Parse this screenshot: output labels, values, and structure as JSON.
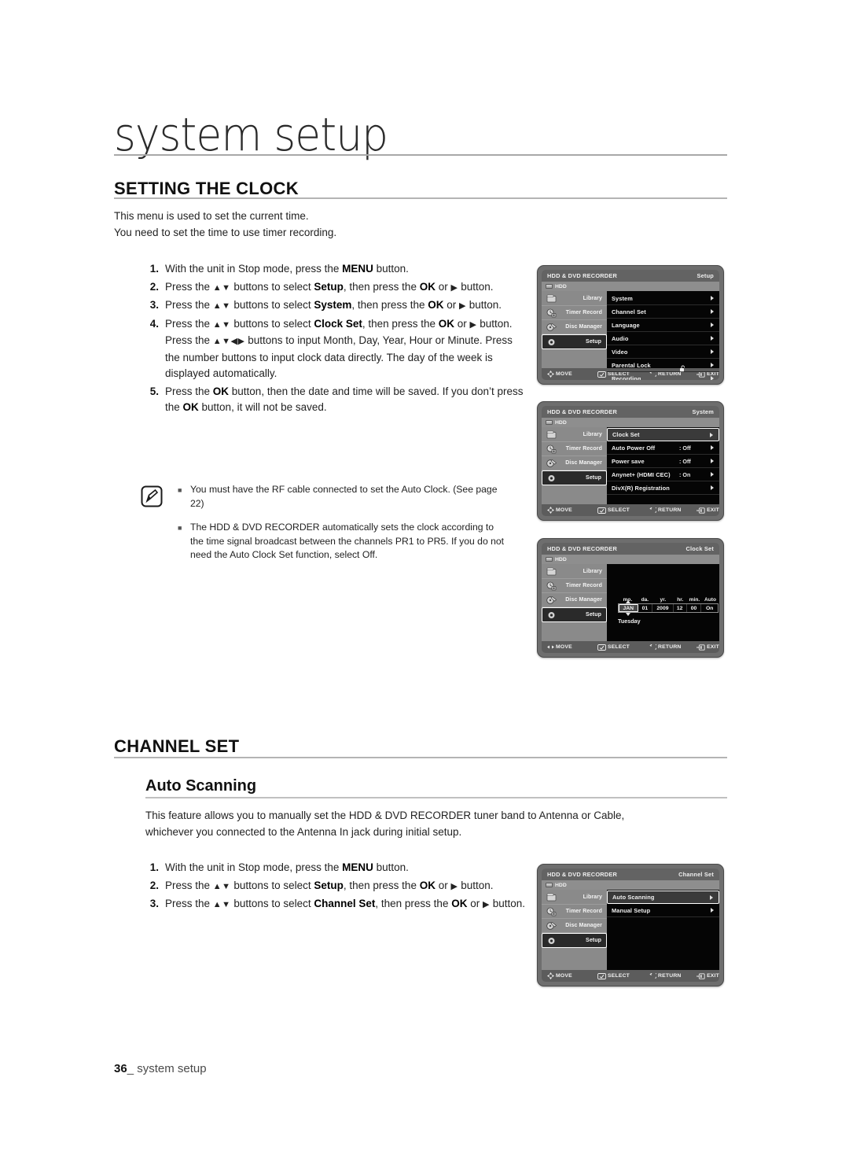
{
  "chapter": {
    "title": "system setup"
  },
  "sections": {
    "clock": {
      "heading": "SETTING THE CLOCK",
      "intro_line1": "This menu is used to set the current time.",
      "intro_line2": "You need to set the time to use timer recording.",
      "steps": [
        {
          "num": "1.",
          "html": "With the unit in Stop mode, press the <b>MENU</b> button."
        },
        {
          "num": "2.",
          "html": "Press the <span class=\"arrowg\">▲▼</span> buttons to select <b>Setup</b>, then press the <b>OK</b> or <span class=\"arrowg\">▶</span> button."
        },
        {
          "num": "3.",
          "html": "Press the <span class=\"arrowg\">▲▼</span> buttons to select <b>System</b>, then press the <b>OK</b> or <span class=\"arrowg\">▶</span> button."
        },
        {
          "num": "4.",
          "html": "Press the <span class=\"arrowg\">▲▼</span> buttons to select <b>Clock Set</b>, then press the <b>OK</b> or <span class=\"arrowg\">▶</span> button.<br>Press the <span class=\"arrowg\">▲▼◀▶</span> buttons to input Month, Day, Year, Hour or Minute. Press the number buttons to input clock data directly. The day of the week is displayed automatically."
        },
        {
          "num": "5.",
          "html": "Press the <b>OK</b> button, then the date and time will be saved. If you don&rsquo;t press the <b>OK</b> button, it will not be saved."
        }
      ],
      "notes": [
        "You must have the RF cable connected to set the Auto Clock. (See page 22)",
        "The HDD & DVD RECORDER automatically sets the clock according to the time signal broadcast between the channels PR1 to PR5. If you do not need the Auto Clock Set function, select Off."
      ]
    },
    "channel": {
      "heading": "CHANNEL SET",
      "subheading": "Auto Scanning",
      "intro_line1": "This feature allows you to manually set the HDD & DVD RECORDER tuner band to Antenna or Cable,",
      "intro_line2": "whichever you connected to the Antenna In jack during initial setup.",
      "steps": [
        {
          "num": "1.",
          "html": "With the unit in Stop mode, press the <b>MENU</b> button."
        },
        {
          "num": "2.",
          "html": "Press the <span class=\"arrowg\">▲▼</span> buttons to select <b>Setup</b>, then press the <b>OK</b> or <span class=\"arrowg\">▶</span> button."
        },
        {
          "num": "3.",
          "html": "Press the <span class=\"arrowg\">▲▼</span> buttons to select <b>Channel Set</b>, then press the <b>OK</b> or <span class=\"arrowg\">▶</span> button."
        }
      ]
    }
  },
  "osd_common": {
    "brand": "HDD & DVD RECORDER",
    "hdd_label": "HDD",
    "sidebar": [
      {
        "label": "Library",
        "icon": "library-icon"
      },
      {
        "label": "Timer Record",
        "icon": "timer-record-icon"
      },
      {
        "label": "Disc Manager",
        "icon": "disc-manager-icon"
      },
      {
        "label": "Setup",
        "icon": "setup-gear-icon"
      }
    ],
    "bottom_bar": {
      "move": "MOVE",
      "select": "SELECT",
      "return": "RETURN",
      "exit": "EXIT"
    }
  },
  "osd_screens": [
    {
      "id": "setup-menu",
      "page_title": "Setup",
      "selected_sidebar": 3,
      "move_mode": "updown",
      "rows": [
        {
          "label": "System",
          "value": "",
          "selected": false,
          "arrow": true
        },
        {
          "label": "Channel Set",
          "value": "",
          "selected": false,
          "arrow": true
        },
        {
          "label": "Language",
          "value": "",
          "selected": false,
          "arrow": true
        },
        {
          "label": "Audio",
          "value": "",
          "selected": false,
          "arrow": true
        },
        {
          "label": "Video",
          "value": "",
          "selected": false,
          "arrow": true
        },
        {
          "label": "Parental Lock",
          "value": "",
          "selected": false,
          "arrow": true,
          "icon": "unlocked-padlock-icon"
        },
        {
          "label": "Recording",
          "value": "",
          "selected": false,
          "arrow": true
        }
      ]
    },
    {
      "id": "system-menu",
      "page_title": "System",
      "selected_sidebar": 3,
      "move_mode": "updown",
      "rows": [
        {
          "label": "Clock Set",
          "value": "",
          "selected": true,
          "arrow": true
        },
        {
          "label": "Auto Power Off",
          "value": ": Off",
          "selected": false,
          "arrow": true
        },
        {
          "label": "Power save",
          "value": ": Off",
          "selected": false,
          "arrow": true
        },
        {
          "label": "Anynet+ (HDMI CEC)",
          "value": ": On",
          "selected": false,
          "arrow": true
        },
        {
          "label": "DivX(R) Registration",
          "value": "",
          "selected": false,
          "arrow": true
        }
      ]
    },
    {
      "id": "clock-set",
      "page_title": "Clock Set",
      "selected_sidebar": 3,
      "move_mode": "leftright",
      "clock": {
        "headers": [
          "mo.",
          "da.",
          "yr.",
          "hr.",
          "min.",
          "Auto"
        ],
        "values": [
          "JAN",
          "01",
          "2009",
          "12",
          "00",
          "On"
        ],
        "selected_index": 0,
        "weekday": "Tuesday"
      }
    },
    {
      "id": "channel-set",
      "page_title": "Channel Set",
      "selected_sidebar": 3,
      "move_mode": "updown",
      "rows": [
        {
          "label": "Auto Scanning",
          "value": "",
          "selected": true,
          "arrow": true
        },
        {
          "label": "Manual Setup",
          "value": "",
          "selected": false,
          "arrow": true
        }
      ]
    }
  ],
  "footer": {
    "page_number": "36",
    "separator": "_",
    "label": "system setup"
  }
}
